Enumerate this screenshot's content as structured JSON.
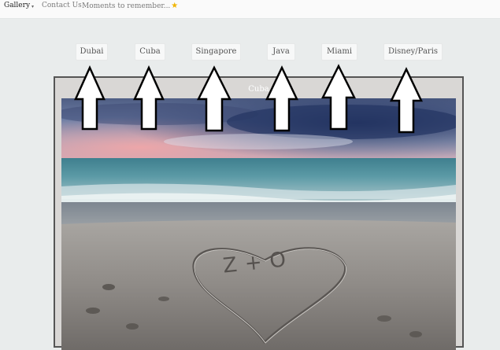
{
  "nav": {
    "gallery": "Gallery",
    "caret": "▾",
    "contact": "Contact Us",
    "moments": "Moments to remember...",
    "star_icon": "★"
  },
  "tabs": [
    "Dubai",
    "Cuba",
    "Singapore",
    "Java",
    "Miami",
    "Disney/Paris"
  ],
  "viewer": {
    "title": "Cuba"
  },
  "photo": {
    "carving": "Z+O",
    "description_icon": "beach-heart-photo"
  },
  "colors": {
    "page_bg": "#e9ecec",
    "frame_bg": "#d9d7d5",
    "star": "#f0b400"
  }
}
